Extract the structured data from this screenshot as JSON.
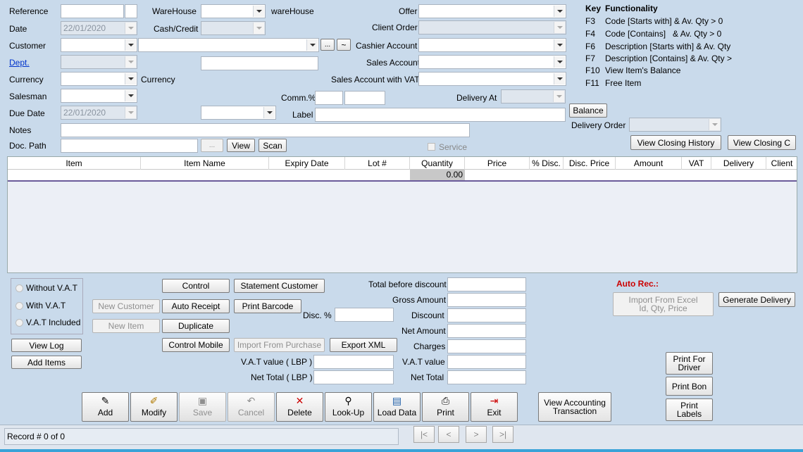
{
  "header": {
    "reference_label": "Reference",
    "date_label": "Date",
    "date_value": "22/01/2020",
    "customer_label": "Customer",
    "dept_label": "Dept.",
    "currency_label": "Currency",
    "currency_label2": "Currency",
    "salesman_label": "Salesman",
    "due_date_label": "Due Date",
    "due_date_value": "22/01/2020",
    "notes_label": "Notes",
    "doc_path_label": "Doc. Path",
    "warehouse_label": "WareHouse",
    "warehouse_label2": "wareHouse",
    "cash_credit_label": "Cash/Credit",
    "offer_label": "Offer",
    "client_order_label": "Client Order",
    "cashier_account_label": "Cashier Account",
    "sales_account_label": "Sales Account",
    "sales_account_vat_label": "Sales Account with VAT",
    "comm_label": "Comm.%",
    "delivery_at_label": "Delivery At",
    "label_label": "Label",
    "service_label": "Service",
    "ellipsis": "...",
    "tilde": "~",
    "view_btn": "View",
    "scan_btn": "Scan"
  },
  "keys": {
    "title_key": "Key",
    "title_func": "Functionality",
    "rows": [
      {
        "k": "F3",
        "v": "Code [Starts with] & Av. Qty > 0"
      },
      {
        "k": "F4",
        "v": "Code [Contains]   & Av. Qty > 0"
      },
      {
        "k": "F6",
        "v": "Description [Starts with] & Av. Qty"
      },
      {
        "k": "F7",
        "v": "Description [Contains] & Av. Qty >"
      },
      {
        "k": "F10",
        "v": "View Item's Balance"
      },
      {
        "k": "F11",
        "v": "Free Item"
      }
    ]
  },
  "right": {
    "balance_btn": "Balance",
    "delivery_order_label": "Delivery Order",
    "view_closing_history": "View Closing History",
    "view_closing_c": "View Closing C"
  },
  "grid": {
    "columns": [
      "Item",
      "Item Name",
      "Expiry Date",
      "Lot #",
      "Quantity",
      "Price",
      "% Disc.",
      "Disc. Price",
      "Amount",
      "VAT",
      "Delivery",
      "Client"
    ],
    "row_quantity": "0.00"
  },
  "options": {
    "without_vat": "Without V.A.T",
    "with_vat": "With V.A.T",
    "vat_included": "V.A.T Included",
    "view_log": "View Log",
    "add_items": "Add Items"
  },
  "actions": {
    "control": "Control",
    "statement_customer": "Statement Customer",
    "new_customer": "New Customer",
    "auto_receipt": "Auto Receipt",
    "print_barcode": "Print Barcode",
    "new_item": "New Item",
    "duplicate": "Duplicate",
    "control_mobile": "Control Mobile",
    "import_from_purchase": "Import From Purchase",
    "export_xml": "Export XML",
    "disc_label": "Disc. %",
    "vat_value_lbp": "V.A.T value ( LBP )",
    "net_total_lbp": "Net Total ( LBP )"
  },
  "totals": {
    "total_before_discount": "Total before discount",
    "gross_amount": "Gross Amount",
    "discount": "Discount",
    "net_amount": "Net Amount",
    "charges": "Charges",
    "vat_value": "V.A.T value",
    "net_total": "Net Total"
  },
  "far_right": {
    "auto_rec": "Auto Rec.:",
    "import_excel": "Import From Excel\nId, Qty, Price",
    "generate_delivery": "Generate Delivery",
    "print_for_driver": "Print For\nDriver",
    "print_bon": "Print Bon",
    "print_labels": "Print\nLabels",
    "view_accounting": "View Accounting\nTransaction"
  },
  "toolbar": {
    "add": "Add",
    "modify": "Modify",
    "save": "Save",
    "cancel": "Cancel",
    "delete": "Delete",
    "lookup": "Look-Up",
    "load_data": "Load Data",
    "print": "Print",
    "exit": "Exit"
  },
  "status": {
    "record": "Record #  0 of 0",
    "first": "|<",
    "prev": "<",
    "next": ">",
    "last": ">|"
  },
  "colors": {
    "accent_red": "#cc0000",
    "link_blue": "#0033cc"
  }
}
